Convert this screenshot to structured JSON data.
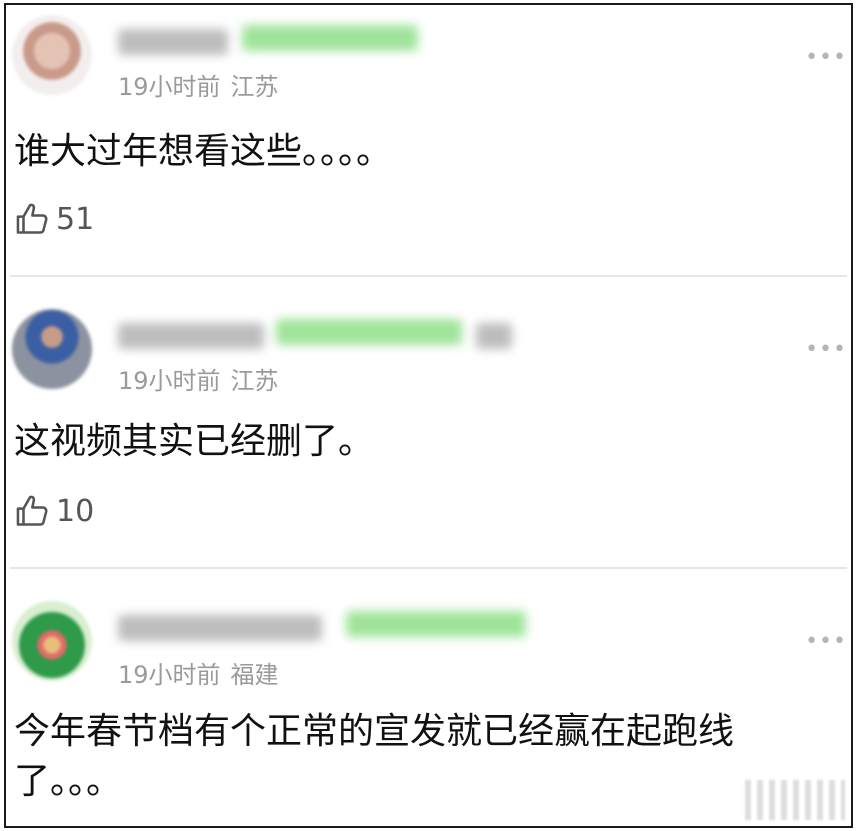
{
  "comments": [
    {
      "time": "19小时前",
      "location": "江苏",
      "text": "谁大过年想看这些。。。。",
      "likes": "51",
      "avatar_icon": "user-avatar-blurred"
    },
    {
      "time": "19小时前",
      "location": "江苏",
      "text": "这视频其实已经删了。",
      "likes": "10",
      "avatar_icon": "user-avatar-blurred"
    },
    {
      "time": "19小时前",
      "location": "福建",
      "text": "今年春节档有个正常的宣发就已经赢在起跑线了。。。",
      "likes": "",
      "avatar_icon": "user-avatar-blurred"
    }
  ],
  "more_label": "•••",
  "like_icon": "thumbs-up-icon",
  "colors": {
    "blurred_badge": "#9fe49a",
    "meta_text": "#9a9a9a"
  }
}
